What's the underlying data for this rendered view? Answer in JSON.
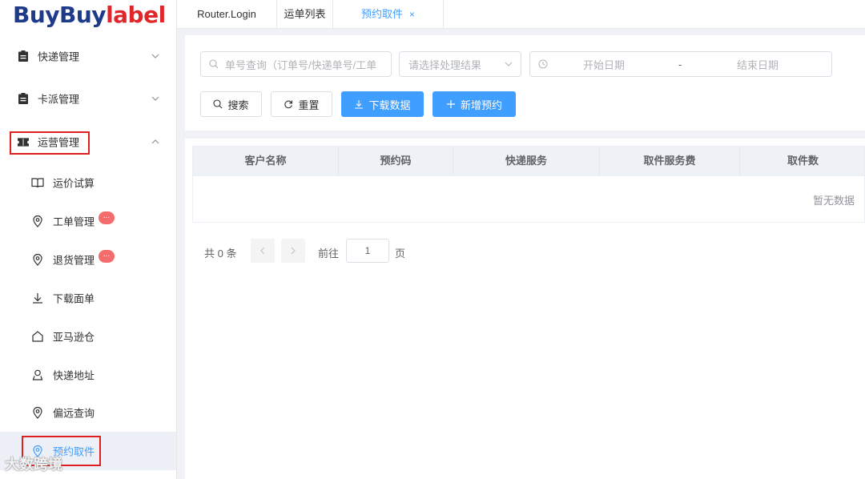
{
  "brand": {
    "part1": "BuyBuy",
    "part2": "label"
  },
  "sidebar": {
    "groups": [
      {
        "label": "快递管理",
        "icon": "clipboard-icon",
        "expanded": false
      },
      {
        "label": "卡派管理",
        "icon": "clipboard-icon",
        "expanded": false
      },
      {
        "label": "运营管理",
        "icon": "ticket-icon",
        "expanded": true
      }
    ],
    "items": [
      {
        "label": "运价试算",
        "icon": "book-icon"
      },
      {
        "label": "工单管理",
        "icon": "location-pin-icon",
        "badge": "..."
      },
      {
        "label": "退货管理",
        "icon": "location-pin-icon",
        "badge": "..."
      },
      {
        "label": "下载面单",
        "icon": "download-icon"
      },
      {
        "label": "亚马逊仓",
        "icon": "home-icon"
      },
      {
        "label": "快递地址",
        "icon": "user-pin-icon"
      },
      {
        "label": "偏远查询",
        "icon": "location-pin-icon"
      },
      {
        "label": "预约取件",
        "icon": "location-pin-icon",
        "active": true
      }
    ],
    "watermark": "大数跨境"
  },
  "tabs": [
    {
      "label": "Router.Login"
    },
    {
      "label": "运单列表"
    },
    {
      "label": "预约取件",
      "active": true,
      "close": "×"
    }
  ],
  "filters": {
    "search_placeholder": "单号查询（订单号/快递单号/工单",
    "result_placeholder": "请选择处理结果",
    "start_date_placeholder": "开始日期",
    "date_separator": "-",
    "end_date_placeholder": "结束日期"
  },
  "actions": {
    "search": "搜索",
    "reset": "重置",
    "download": "下载数据",
    "add": "新增预约"
  },
  "table": {
    "columns": [
      "客户名称",
      "预约码",
      "快递服务",
      "取件服务费",
      "取件数"
    ],
    "empty_text": "暂无数据"
  },
  "pagination": {
    "total": "共 0 条",
    "prev": "<",
    "next": ">",
    "goto_label": "前往",
    "page": "1",
    "page_suffix": "页"
  },
  "colors": {
    "accent": "#409eff",
    "highlight_box": "#e02020",
    "badge": "#f56c6c"
  }
}
